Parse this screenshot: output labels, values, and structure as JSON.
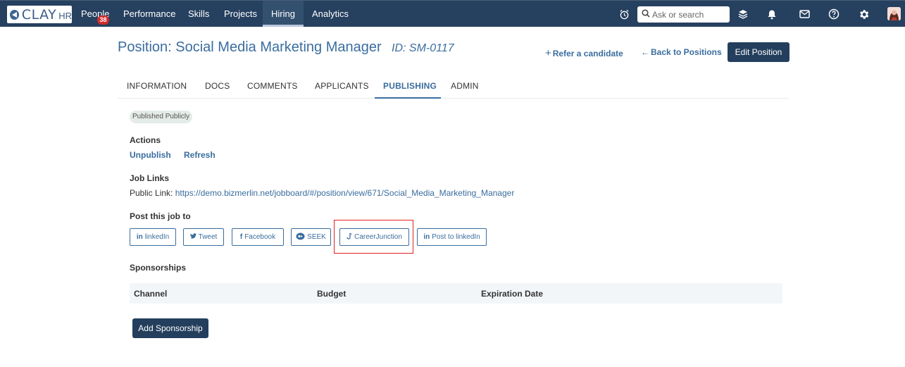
{
  "nav": {
    "logo_main": "CLAY",
    "logo_sub": "HR",
    "items": [
      {
        "label": "People",
        "badge": "38"
      },
      {
        "label": "Performance"
      },
      {
        "label": "Skills"
      },
      {
        "label": "Projects"
      },
      {
        "label": "Hiring"
      },
      {
        "label": "Analytics"
      }
    ],
    "active_item": "Hiring",
    "search_placeholder": "Ask or search"
  },
  "header": {
    "title": "Position: Social Media Marketing Manager",
    "id": "ID: SM-0117",
    "refer_label": "Refer a candidate",
    "back_label": "Back to Positions",
    "edit_label": "Edit Position"
  },
  "tabs": [
    {
      "label": "INFORMATION"
    },
    {
      "label": "DOCS"
    },
    {
      "label": "COMMENTS"
    },
    {
      "label": "APPLICANTS"
    },
    {
      "label": "PUBLISHING"
    },
    {
      "label": "ADMIN"
    }
  ],
  "active_tab": "PUBLISHING",
  "publishing": {
    "status": "Published Publicly",
    "actions_label": "Actions",
    "unpublish_label": "Unpublish",
    "refresh_label": "Refresh",
    "job_links_label": "Job Links",
    "public_link_label": "Public Link:",
    "public_link_url": "https://demo.bizmerlin.net/jobboard/#/position/view/671/Social_Media_Marketing_Manager",
    "post_label": "Post this job to",
    "post_buttons": [
      {
        "label": "linkedIn",
        "icon": "linkedin-icon"
      },
      {
        "label": "Tweet",
        "icon": "twitter-icon"
      },
      {
        "label": "Facebook",
        "icon": "facebook-icon"
      },
      {
        "label": "SEEK",
        "icon": "seek-icon"
      },
      {
        "label": "CareerJunction",
        "icon": "careerjunction-icon"
      },
      {
        "label": "Post to linkedIn",
        "icon": "linkedin-icon"
      }
    ],
    "sponsorships_label": "Sponsorships",
    "table_headers": [
      "Channel",
      "Budget",
      "Expiration Date"
    ],
    "add_sponsorship_label": "Add Sponsorship"
  },
  "colors": {
    "nav_bg": "#26405f",
    "accent": "#3a6d9e",
    "primary_button": "#243f5d",
    "badge": "#d12b2b",
    "highlight": "#e02020"
  }
}
